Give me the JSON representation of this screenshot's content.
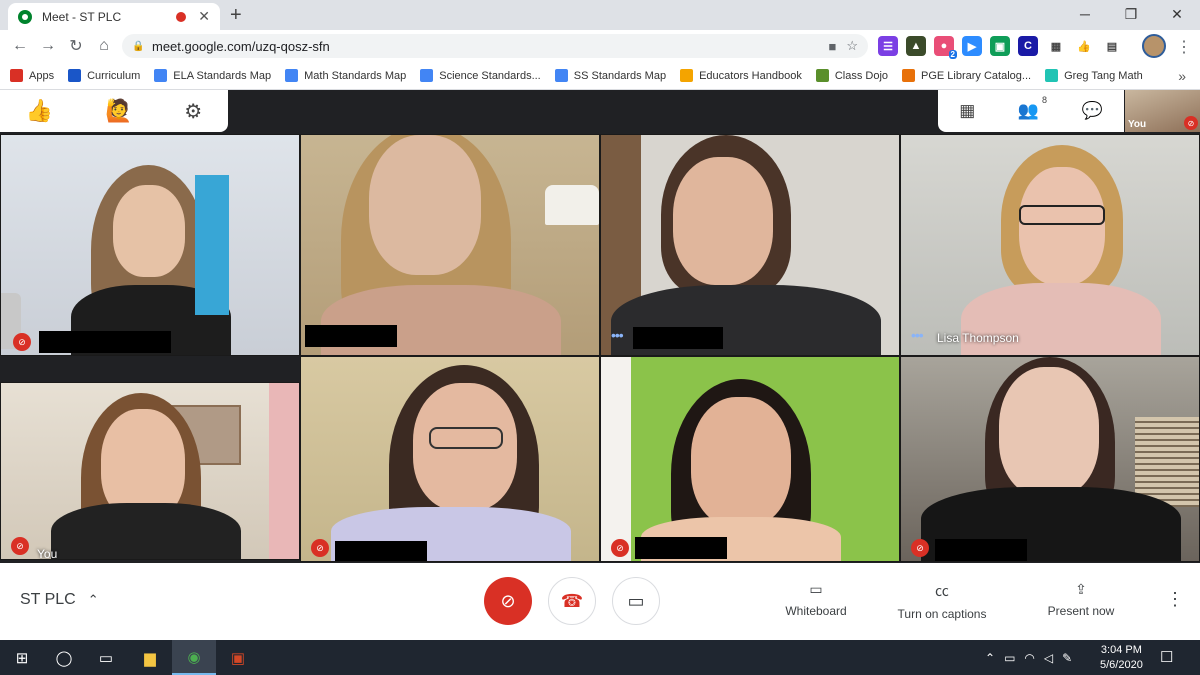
{
  "browser": {
    "tab_title": "Meet - ST PLC",
    "close_tab": "✕",
    "new_tab": "+",
    "window_controls": [
      "─",
      "❐",
      "✕"
    ],
    "url": "meet.google.com/uzq-qosz-sfn",
    "nav": {
      "back": "←",
      "forward": "→",
      "reload": "↻",
      "home": "⌂"
    },
    "extension_badge": "2"
  },
  "bookmarks": [
    {
      "label": "Apps",
      "color": "#d93025"
    },
    {
      "label": "Curriculum",
      "color": "#1a56c8"
    },
    {
      "label": "ELA Standards Map",
      "color": "#4285f4"
    },
    {
      "label": "Math Standards Map",
      "color": "#4285f4"
    },
    {
      "label": "Science Standards...",
      "color": "#4285f4"
    },
    {
      "label": "SS Standards Map",
      "color": "#4285f4"
    },
    {
      "label": "Educators Handbook",
      "color": "#f4a400"
    },
    {
      "label": "Class Dojo",
      "color": "#5a8f2b"
    },
    {
      "label": "PGE Library Catalog...",
      "color": "#e8710a"
    },
    {
      "label": "Greg Tang Math",
      "color": "#21c4b4"
    }
  ],
  "meet": {
    "top_left": {
      "thumbs": "👍",
      "hand": "🙋",
      "settings": "⚙"
    },
    "top_right": {
      "grid": "▦",
      "participants": "👥",
      "participants_count": "8",
      "chat": "💬"
    },
    "self_view_label": "You",
    "tiles": [
      {
        "name": "",
        "muted": true,
        "speaking": false
      },
      {
        "name": "",
        "muted": false,
        "speaking": false
      },
      {
        "name": "",
        "muted": false,
        "speaking": true
      },
      {
        "name": "Lisa Thompson",
        "muted": false,
        "speaking": true
      },
      {
        "name": "You",
        "muted": true,
        "speaking": false
      },
      {
        "name": "",
        "muted": true,
        "speaking": false
      },
      {
        "name": "",
        "muted": true,
        "speaking": false
      },
      {
        "name": "",
        "muted": true,
        "speaking": false
      }
    ],
    "meeting_name": "ST PLC",
    "chevron": "⌃",
    "actions": {
      "whiteboard": "Whiteboard",
      "captions": "Turn on captions",
      "present": "Present now"
    },
    "more": "⋮"
  },
  "taskbar": {
    "time": "3:04 PM",
    "date": "5/6/2020"
  },
  "colors": {
    "accent_red": "#d93025",
    "meet_bg": "#202124",
    "taskbar_bg": "#1f2630"
  }
}
